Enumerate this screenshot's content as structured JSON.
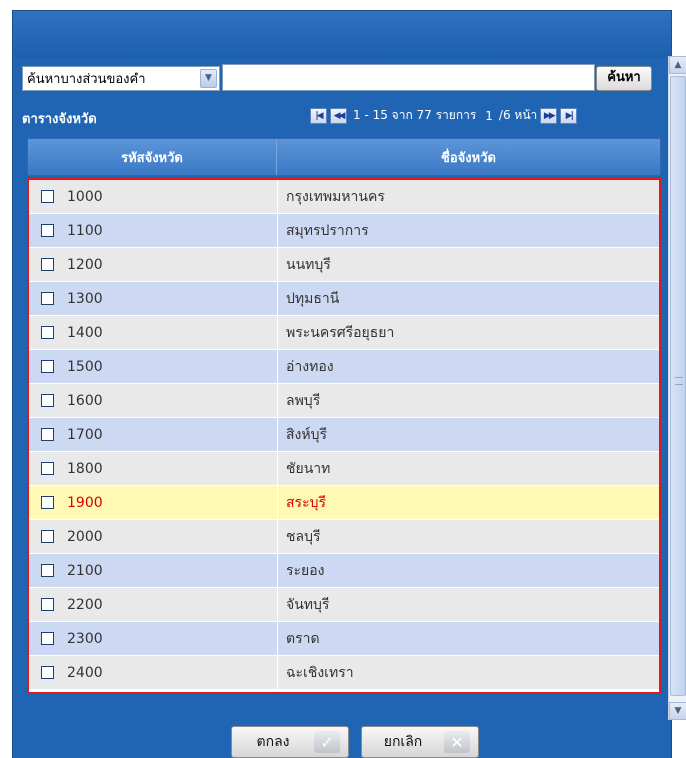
{
  "search": {
    "mode_value": "ค้นหาบางส่วนของคำ",
    "query_value": "",
    "button_label": "ค้นหา"
  },
  "table": {
    "title": "ตารางจังหวัด",
    "pager": {
      "range_text": "1 - 15 จาก 77 รายการ",
      "current_page": "1",
      "total_text": "/6 หน้า"
    },
    "columns": {
      "code": "รหัสจังหวัด",
      "name": "ชื่อจังหวัด"
    },
    "rows": [
      {
        "code": "1000",
        "name": "กรุงเทพมหานคร"
      },
      {
        "code": "1100",
        "name": "สมุทรปราการ"
      },
      {
        "code": "1200",
        "name": "นนทบุรี"
      },
      {
        "code": "1300",
        "name": "ปทุมธานี"
      },
      {
        "code": "1400",
        "name": "พระนครศรีอยุธยา"
      },
      {
        "code": "1500",
        "name": "อ่างทอง"
      },
      {
        "code": "1600",
        "name": "ลพบุรี"
      },
      {
        "code": "1700",
        "name": "สิงห์บุรี"
      },
      {
        "code": "1800",
        "name": "ชัยนาท"
      },
      {
        "code": "1900",
        "name": "สระบุรี"
      },
      {
        "code": "2000",
        "name": "ชลบุรี"
      },
      {
        "code": "2100",
        "name": "ระยอง"
      },
      {
        "code": "2200",
        "name": "จันทบุรี"
      },
      {
        "code": "2300",
        "name": "ตราด"
      },
      {
        "code": "2400",
        "name": "ฉะเชิงเทรา"
      }
    ],
    "highlighted_row_index": 9
  },
  "footer": {
    "ok_label": "ตกลง",
    "cancel_label": "ยกเลิก"
  },
  "colors": {
    "dialog_blue": "#1f65b4",
    "row_even": "#cdd9f3",
    "row_odd": "#e9e9ea",
    "highlight_bg": "#fff9b5",
    "highlight_text": "#d80000",
    "selection_border": "#dd1b1b"
  }
}
